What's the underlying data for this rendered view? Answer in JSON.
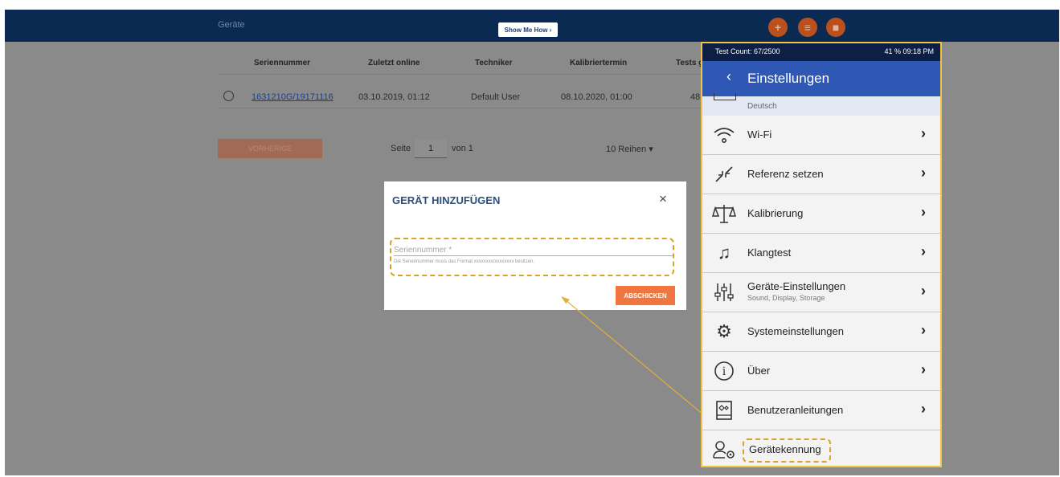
{
  "header": {
    "title": "Geräte",
    "show_me_how": "Show Me How ›",
    "action_icons": [
      "plus-icon",
      "filter-icon",
      "list-icon"
    ]
  },
  "table": {
    "columns": [
      "Seriennummer",
      "Zuletzt online",
      "Techniker",
      "Kalibriertermin",
      "Tests ge"
    ],
    "rows": [
      {
        "serial": "1631210G/19171116",
        "last_online": "03.10.2019, 01:12",
        "technician": "Default User",
        "calibration": "08.10.2020, 01:00",
        "tests": "48"
      }
    ]
  },
  "pagination": {
    "prev_label": "VORHERIGE",
    "page_label": "Seite",
    "page_value": "1",
    "of_label": "von 1",
    "rows_label": "10 Reihen ▾"
  },
  "modal": {
    "title": "GERÄT HINZUFÜGEN",
    "close": "×",
    "serial_placeholder": "Seriennummer *",
    "help_text": "Die Seriennummer muss das Format xxxxxxxx/xxxxxxxx besitzen.",
    "submit_label": "ABSCHICKEN"
  },
  "device": {
    "status_left": "Test Count: 67/2500",
    "status_right": "41 % 09:18 PM",
    "title": "Einstellungen",
    "language_value": "Deutsch",
    "menu": [
      {
        "label": "Wi-Fi",
        "icon": "wifi-icon"
      },
      {
        "label": "Referenz setzen",
        "icon": "reference-icon"
      },
      {
        "label": "Kalibrierung",
        "icon": "calibration-icon"
      },
      {
        "label": "Klangtest",
        "icon": "music-note-icon"
      },
      {
        "label": "Geräte-Einstellungen",
        "sublabel": "Sound, Display, Storage",
        "icon": "sliders-icon"
      },
      {
        "label": "Systemeinstellungen",
        "icon": "gears-icon"
      },
      {
        "label": "Über",
        "icon": "info-icon"
      },
      {
        "label": "Benutzeranleitungen",
        "icon": "guide-icon"
      },
      {
        "label": "Gerätekennung",
        "icon": "user-gear-icon"
      }
    ]
  },
  "colors": {
    "topbar": "#0b2a52",
    "accent": "#f0763f",
    "highlight": "#d8a22c",
    "device_header": "#2f58b4"
  }
}
